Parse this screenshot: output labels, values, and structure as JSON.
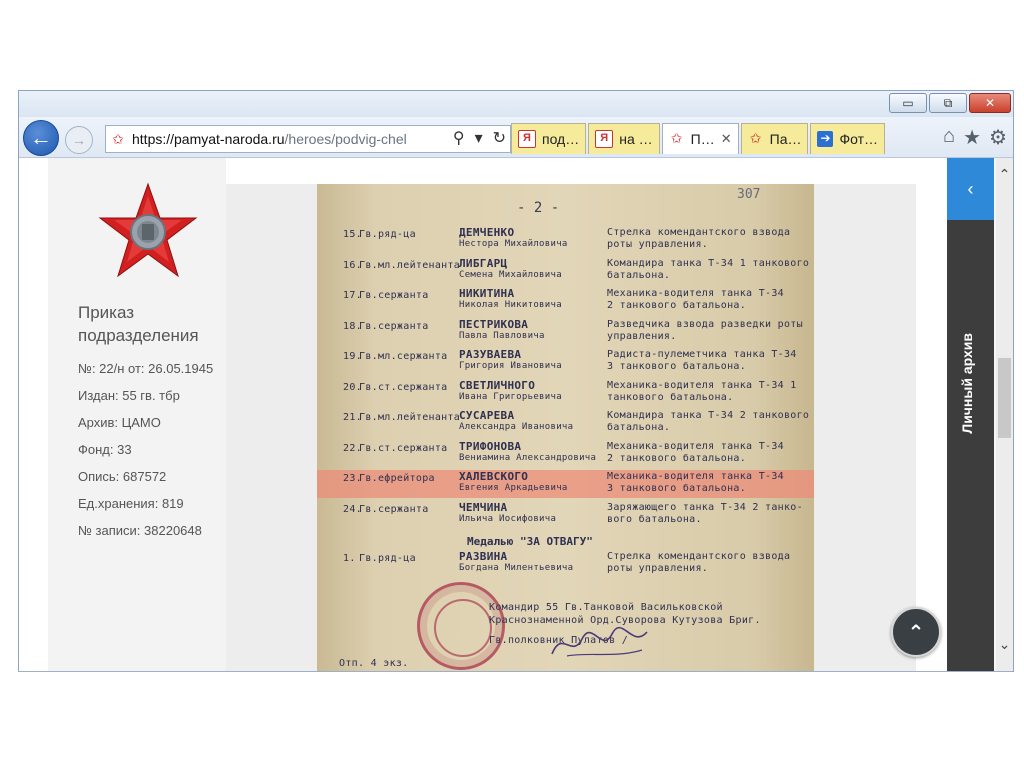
{
  "browser": {
    "url_host": "https://pamyat-naroda.ru",
    "url_path": "/heroes/podvig-chel",
    "tabs": [
      {
        "label": "под…",
        "icon": "yandex-icon",
        "active": false
      },
      {
        "label": "на …",
        "icon": "yandex-icon",
        "active": false
      },
      {
        "label": "П…",
        "icon": "star-icon",
        "active": true,
        "close": "✕"
      },
      {
        "label": "Па…",
        "icon": "star-icon",
        "active": false
      },
      {
        "label": "Фот…",
        "icon": "arrow-icon",
        "active": false
      }
    ],
    "window_buttons": {
      "minimize": "▭",
      "restore": "⧉",
      "close": "✕"
    },
    "back_glyph": "←",
    "forward_glyph": "→",
    "search_glyph": "⚲",
    "dropdown_glyph": "▾",
    "refresh_glyph": "↻",
    "home_glyph": "⌂",
    "favorites_glyph": "★",
    "settings_glyph": "⚙"
  },
  "info": {
    "title": "Приказ подразделения",
    "lines": [
      "№: 22/н от: 26.05.1945",
      "Издан: 55 гв. тбр",
      "Архив: ЦАМО",
      "Фонд: 33",
      "Опись: 687572",
      "Ед.хранения: 819",
      "№ записи: 38220648"
    ]
  },
  "document": {
    "page_marker": "- 2 -",
    "corner_number": "307",
    "rows": [
      {
        "num": "15.",
        "rank": "Гв.ряд-ца",
        "name": "ДЕМЧЕНКО",
        "patronymic": "Нестора Михайловича",
        "role": "Стрелка комендантского взвода",
        "role2": "роты управления.",
        "highlight": false
      },
      {
        "num": "16.",
        "rank": "Гв.мл.лейтенанта",
        "name": "ЛИБГАРЦ",
        "patronymic": "Семена Михайловича",
        "role": "Командира танка Т-34 1 танкового",
        "role2": "батальона.",
        "highlight": false
      },
      {
        "num": "17.",
        "rank": "Гв.сержанта",
        "name": "НИКИТИНА",
        "patronymic": "Николая Никитовича",
        "role": "Механика-водителя танка Т-34",
        "role2": "2 танкового батальона.",
        "highlight": false
      },
      {
        "num": "18.",
        "rank": "Гв.сержанта",
        "name": "ПЕСТРИКОВА",
        "patronymic": "Павла Павловича",
        "role": "Разведчика взвода разведки роты",
        "role2": "управления.",
        "highlight": false
      },
      {
        "num": "19.",
        "rank": "Гв.мл.сержанта",
        "name": "РАЗУВАЕВА",
        "patronymic": "Григория Ивановича",
        "role": "Радиста-пулеметчика танка Т-34",
        "role2": "3 танкового батальона.",
        "highlight": false
      },
      {
        "num": "20.",
        "rank": "Гв.ст.сержанта",
        "name": "СВЕТЛИЧНОГО",
        "patronymic": "Ивана Григорьевича",
        "role": "Механика-водителя танка Т-34 1",
        "role2": "танкового батальона.",
        "highlight": false
      },
      {
        "num": "21.",
        "rank": "Гв.мл.лейтенанта",
        "name": "СУСАРЕВА",
        "patronymic": "Александра Ивановича",
        "role": "Командира танка Т-34 2 танкового",
        "role2": "батальона.",
        "highlight": false
      },
      {
        "num": "22.",
        "rank": "Гв.ст.сержанта",
        "name": "ТРИФОНОВА",
        "patronymic": "Вениамина Александровича",
        "role": "Механика-водителя танка Т-34",
        "role2": "2 танкового батальона.",
        "highlight": false
      },
      {
        "num": "23.",
        "rank": "Гв.ефрейтора",
        "name": "ХАЛЕВСКОГО",
        "patronymic": "Евгения Аркадьевича",
        "role": "Механика-водителя танка Т-34",
        "role2": "3 танкового батальона.",
        "highlight": true
      },
      {
        "num": "24.",
        "rank": "Гв.сержанта",
        "name": "ЧЕМЧИНА",
        "patronymic": "Ильича Иосифовича",
        "role": "Заряжающего танка Т-34 2 танко-",
        "role2": "вого батальона.",
        "highlight": false
      }
    ],
    "medal_heading": "Медалью \"ЗА ОТВАГУ\"",
    "last_row": {
      "num": "1.",
      "rank": "Гв.ряд-ца",
      "name": "РАЗВИНА",
      "patronymic": "Богдана Милентьевича",
      "role": "Стрелка комендантского взвода",
      "role2": "роты управления."
    },
    "signature_line1": "Командир 55 Гв.Танковой Васильковской",
    "signature_line2": "Краснознаменной Орд.Суворова Кутузова Бриг.",
    "signature_line3": "Гв.полковник                Пулатов /",
    "footer": "Отп. 4 экз."
  },
  "sidebar": {
    "label": "Личный архив",
    "toggle_glyph": "‹",
    "scroll_up": "⌃",
    "scroll_down": "⌄"
  },
  "to_top_glyph": "⌃",
  "colors": {
    "accent_blue": "#2e8ad8",
    "sidebar_dark": "#3d3d3d",
    "highlight_row": "#eb8c78",
    "star_red": "#d21f1f"
  }
}
